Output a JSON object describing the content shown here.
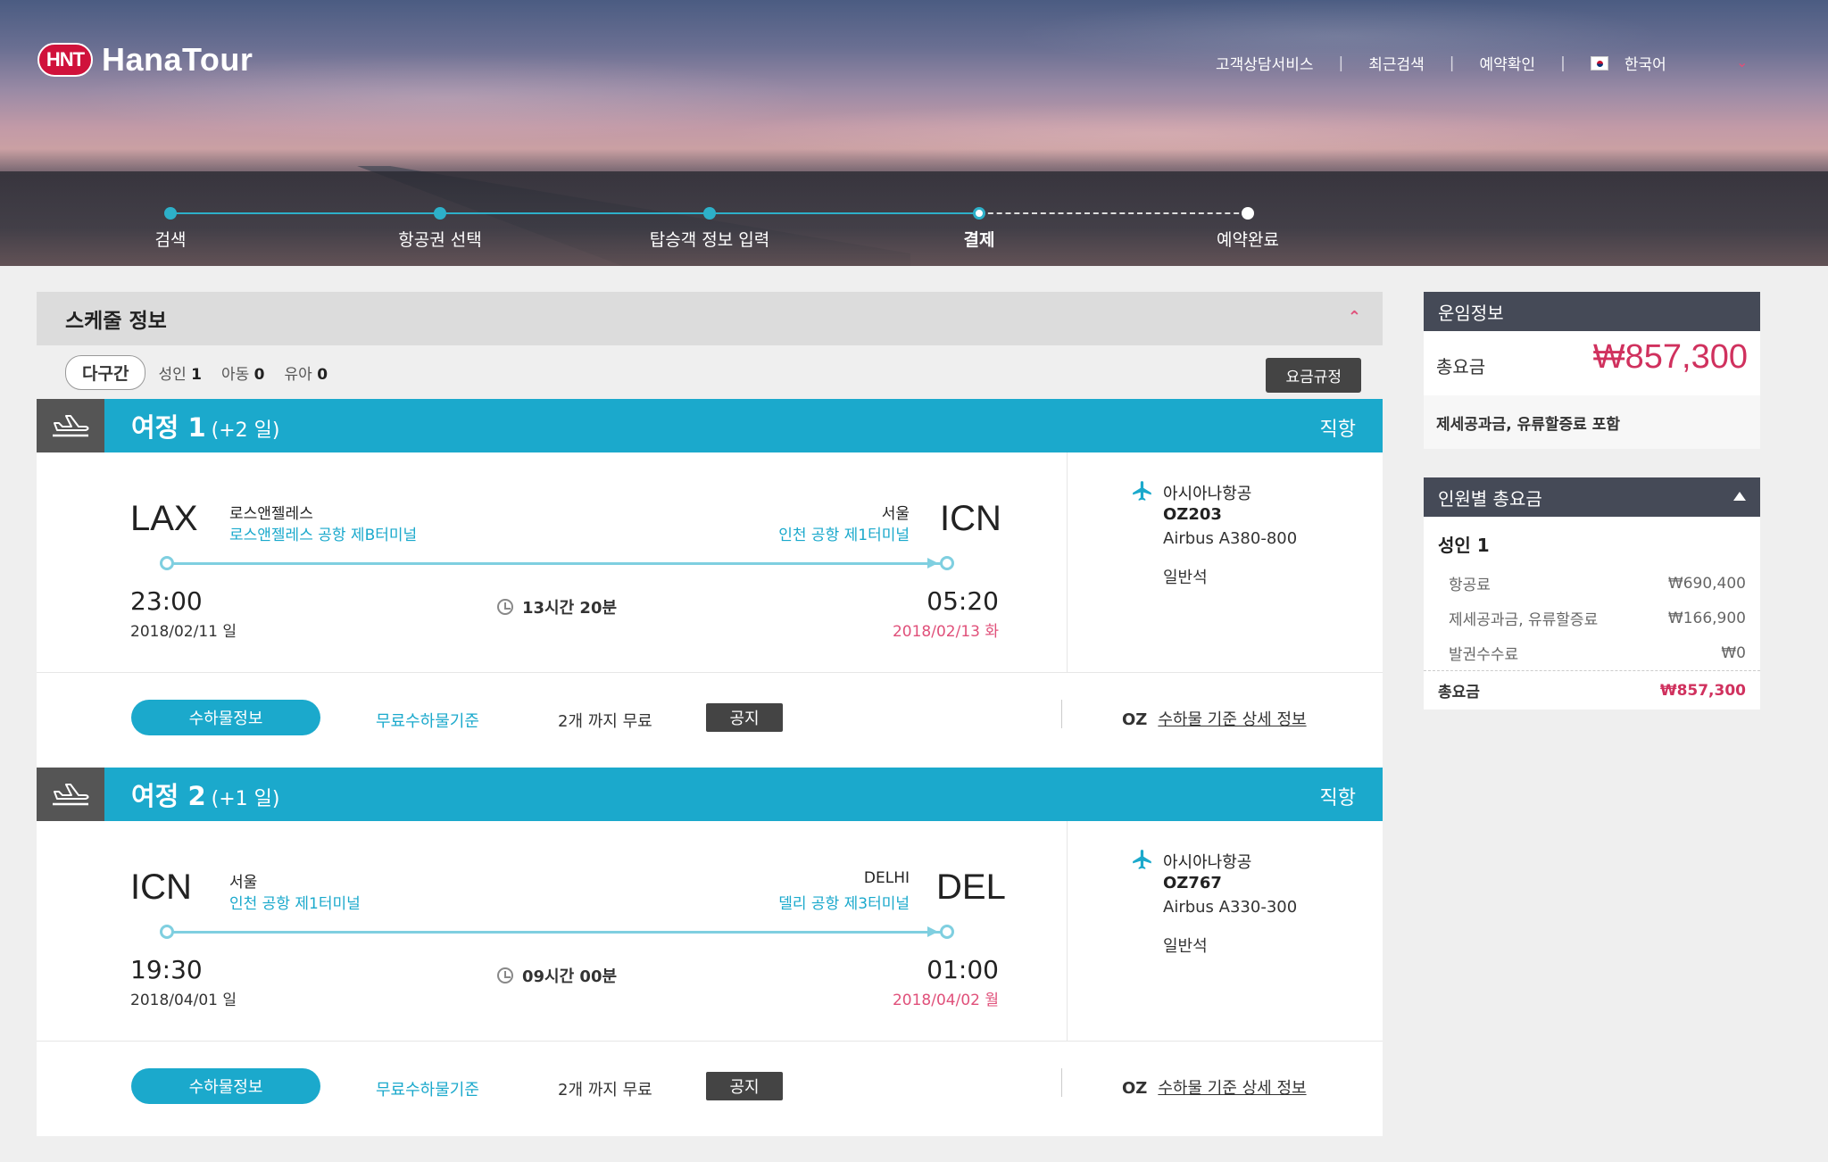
{
  "brand": {
    "mark": "HNT",
    "name": "HanaTour"
  },
  "topnav": {
    "items": [
      "고객상담서비스",
      "최근검색",
      "예약확인"
    ],
    "separator": "|",
    "language": "한국어"
  },
  "stepper": {
    "steps": [
      "검색",
      "항공권 선택",
      "탑승객 정보 입력",
      "결제",
      "예약완료"
    ],
    "current": 3
  },
  "schedule": {
    "title": "스케줄 정보",
    "trip_type": "다구간",
    "pax": [
      {
        "label": "성인",
        "count": "1"
      },
      {
        "label": "아동",
        "count": "0"
      },
      {
        "label": "유아",
        "count": "0"
      }
    ],
    "fare_rules_button": "요금규정"
  },
  "legs": [
    {
      "title": "여정 1",
      "day_offset": "(+2 일)",
      "direct": "직항",
      "dep": {
        "code": "LAX",
        "city": "로스앤젤레스",
        "terminal": "로스앤젤레스 공항 제B터미널",
        "time": "23:00",
        "date": "2018/02/11 일"
      },
      "arr": {
        "code": "ICN",
        "city": "서울",
        "terminal": "인천 공항 제1터미널",
        "time": "05:20",
        "date": "2018/02/13 화"
      },
      "duration": "13시간 20분",
      "airline": "아시아나항공",
      "flight_no": "OZ203",
      "aircraft": "Airbus A380-800",
      "cabin": "일반석",
      "baggage": {
        "button": "수하물정보",
        "link": "무료수하물기준",
        "free": "2개 까지 무료",
        "notice": "공지",
        "carrier": "OZ",
        "detail": "수하물 기준 상세 정보"
      }
    },
    {
      "title": "여정 2",
      "day_offset": "(+1 일)",
      "direct": "직항",
      "dep": {
        "code": "ICN",
        "city": "서울",
        "terminal": "인천 공항 제1터미널",
        "time": "19:30",
        "date": "2018/04/01 일"
      },
      "arr": {
        "code": "DEL",
        "city": "DELHI",
        "terminal": "델리 공항 제3터미널",
        "time": "01:00",
        "date": "2018/04/02 월"
      },
      "duration": "09시간 00분",
      "airline": "아시아나항공",
      "flight_no": "OZ767",
      "aircraft": "Airbus A330-300",
      "cabin": "일반석",
      "baggage": {
        "button": "수하물정보",
        "link": "무료수하물기준",
        "free": "2개 까지 무료",
        "notice": "공지",
        "carrier": "OZ",
        "detail": "수하물 기준 상세 정보"
      }
    }
  ],
  "fare": {
    "title": "운임정보",
    "total_label": "총요금",
    "total": "₩857,300",
    "note": "제세공과금, 유류할증료 포함"
  },
  "per_person": {
    "title": "인원별 총요금",
    "group": "성인 1",
    "lines": [
      {
        "label": "항공료",
        "value": "₩690,400"
      },
      {
        "label": "제세공과금, 유류할증료",
        "value": "₩166,900"
      },
      {
        "label": "발권수수료",
        "value": "₩0"
      }
    ],
    "total_label": "총요금",
    "total": "₩857,300"
  },
  "colors": {
    "accent": "#1ba9cc",
    "price": "#d0315e",
    "header_dark": "#454a57"
  },
  "icons": {
    "leg": "airplane-takeoff-icon",
    "airline": "airplane-icon",
    "duration": "clock-icon"
  }
}
